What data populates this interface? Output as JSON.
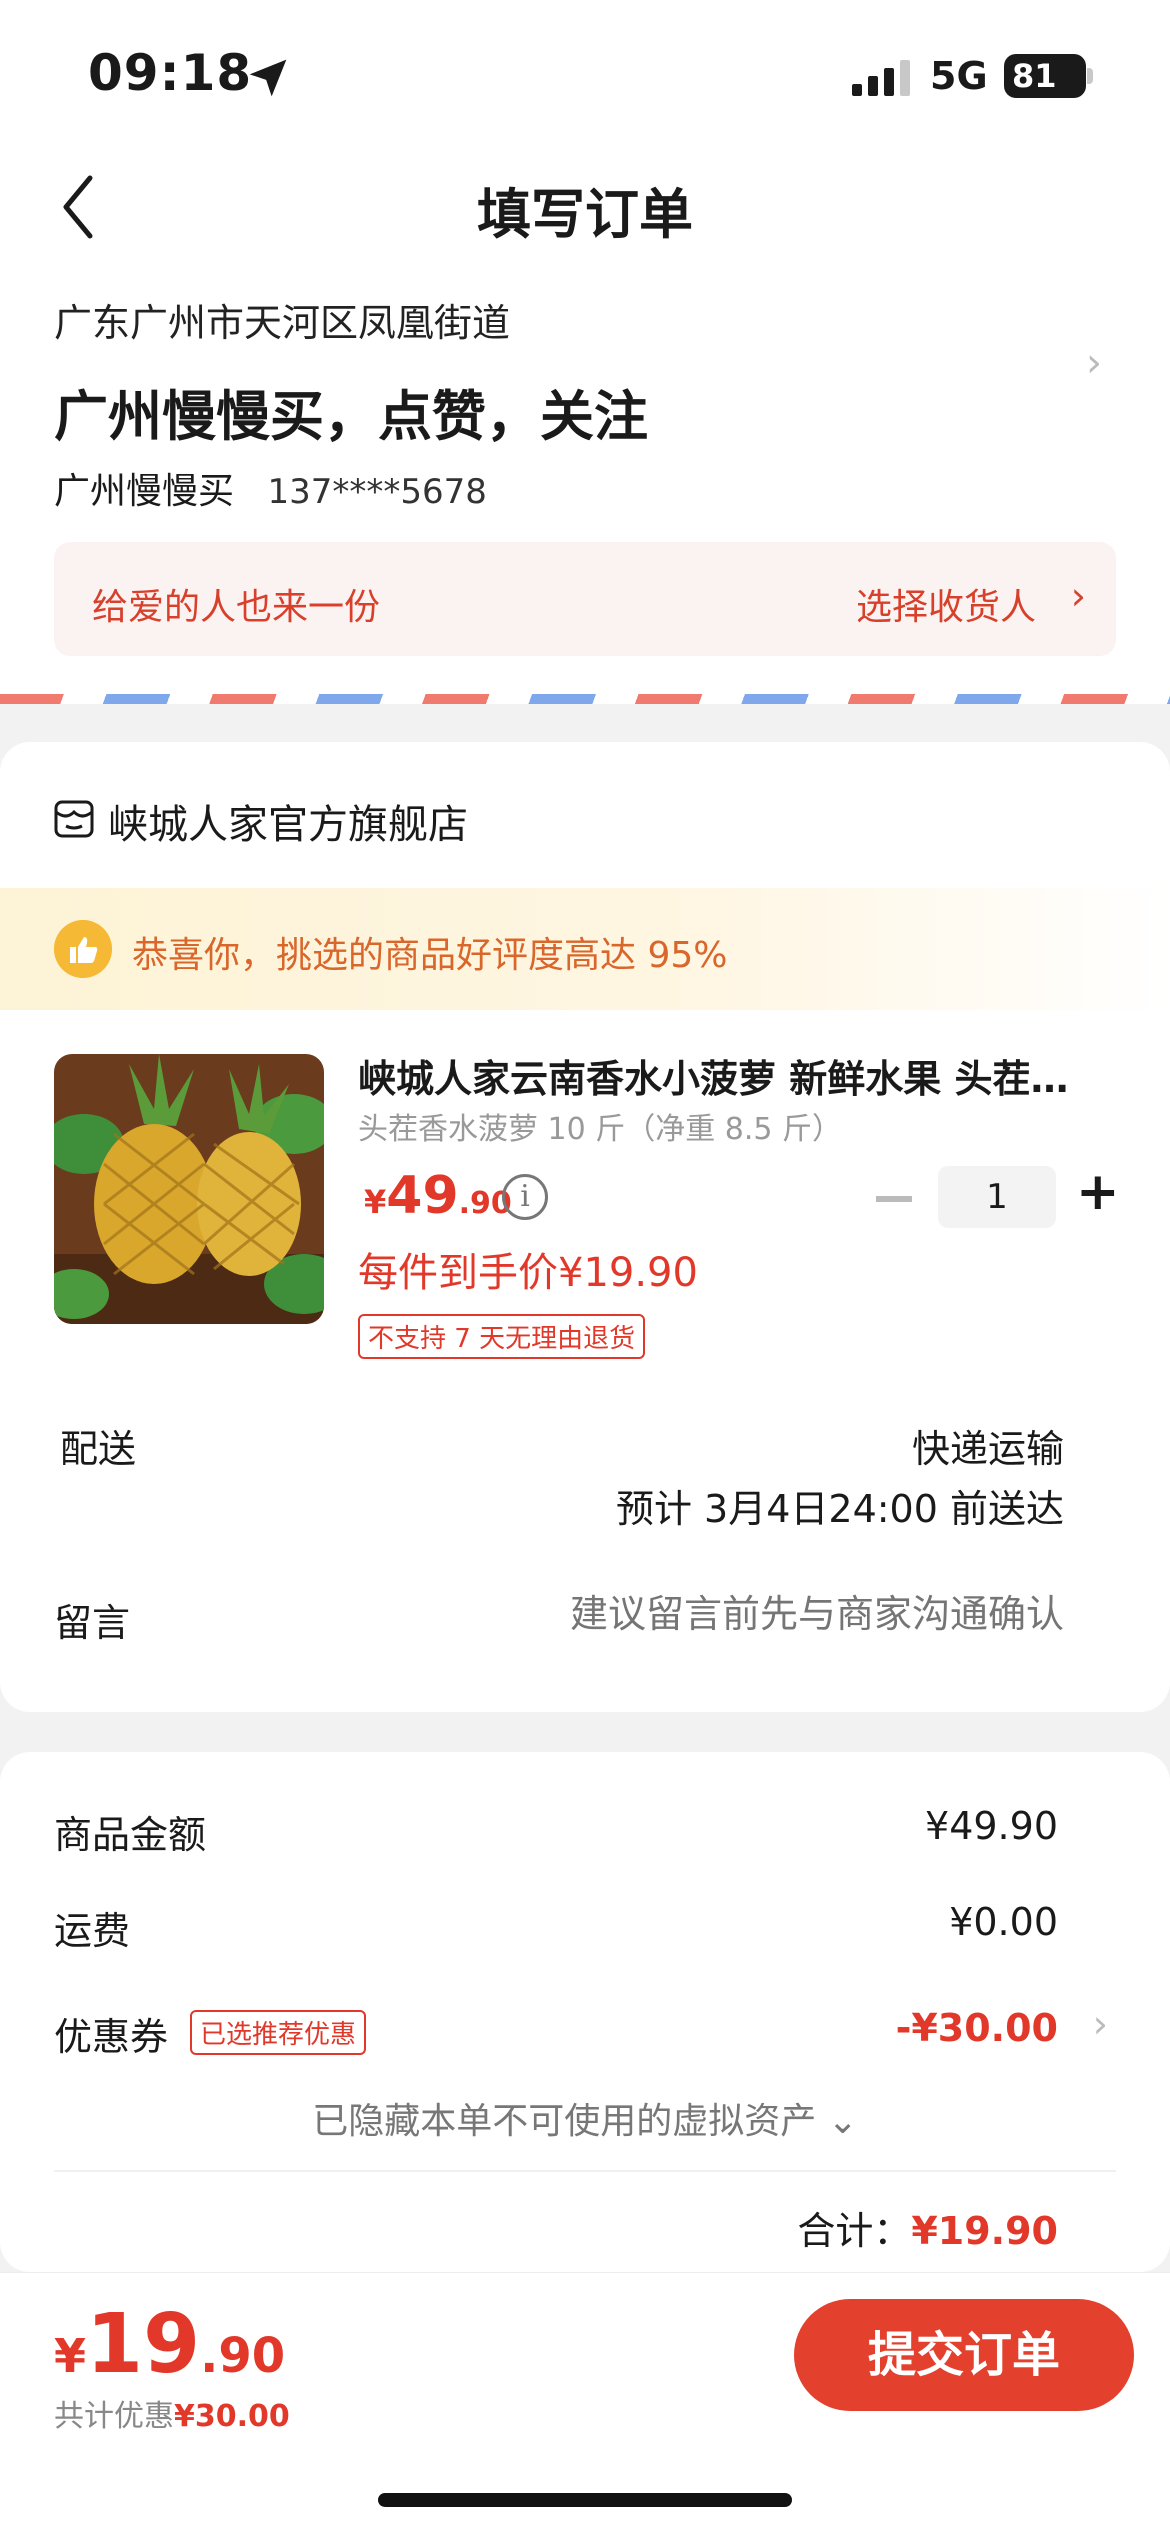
{
  "status_bar": {
    "time": "09:18",
    "network": "5G",
    "battery": "81"
  },
  "header": {
    "title": "填写订单"
  },
  "address": {
    "region": "广东广州市天河区凤凰街道",
    "detail": "广州慢慢买，点赞，关注",
    "name": "广州慢慢买",
    "phone": "137****5678"
  },
  "gift": {
    "left_text": "给爱的人也来一份",
    "right_text": "选择收货人"
  },
  "store": {
    "name": "峡城人家官方旗舰店"
  },
  "praise": {
    "text": "恭喜你，挑选的商品好评度高达 95%"
  },
  "product": {
    "title": "峡城人家云南香水小菠萝 新鲜水果 头茬…",
    "spec": "头茬香水菠萝 10 斤（净重 8.5 斤）",
    "price_symbol": "¥",
    "price_int": "49",
    "price_dec": ".90",
    "unit_price": "每件到手价¥19.90",
    "no_return": "不支持 7 天无理由退货",
    "quantity": "1",
    "info_icon": "i",
    "plus": "+"
  },
  "shipping": {
    "label": "配送",
    "method": "快递运输",
    "eta": "预计 3月4日24:00 前送达"
  },
  "message": {
    "label": "留言",
    "placeholder": "建议留言前先与商家沟通确认"
  },
  "summary": {
    "goods_label": "商品金额",
    "goods_value": "¥49.90",
    "freight_label": "运费",
    "freight_value": "¥0.00",
    "coupon_label": "优惠券",
    "coupon_tag": "已选推荐优惠",
    "coupon_value": "-¥30.00",
    "hidden_assets": "已隐藏本单不可使用的虚拟资产 ⌄",
    "total_label": "合计：",
    "total_value": "¥19.90"
  },
  "bottom": {
    "price_symbol": "¥",
    "price_int": "19",
    "price_dec": ".90",
    "discount_label": "共计优惠",
    "discount_value": "¥30.00",
    "submit_label": "提交订单"
  },
  "colors": {
    "accent": "#e3402e",
    "price": "#e1382a",
    "praise": "#d9662a",
    "background": "#f2f2f2"
  }
}
